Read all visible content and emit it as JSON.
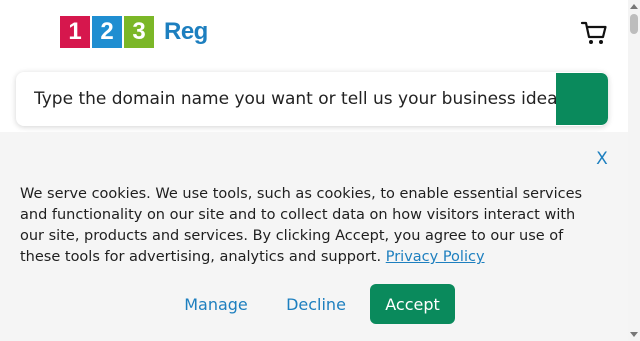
{
  "header": {
    "logo": {
      "digits": [
        "1",
        "2",
        "3"
      ],
      "word": "Reg"
    },
    "cart_icon": "shopping-cart-icon"
  },
  "search": {
    "placeholder": "Type the domain name you want or tell us your business idea",
    "button_icon": "search-button"
  },
  "cookie_banner": {
    "close_label": "X",
    "text": "We serve cookies. We use tools, such as cookies, to enable essential services and functionality on our site and to collect data on how visitors interact with our site, products and services. By clicking Accept, you agree to our use of these tools for advertising, analytics and support.",
    "privacy_link": "Privacy Policy",
    "manage_label": "Manage",
    "decline_label": "Decline",
    "accept_label": "Accept"
  },
  "colors": {
    "brand_red": "#d6174d",
    "brand_blue": "#1f8ed1",
    "brand_green": "#7bb727",
    "link_blue": "#1d7fbf",
    "accept_green": "#0a8a5c"
  }
}
